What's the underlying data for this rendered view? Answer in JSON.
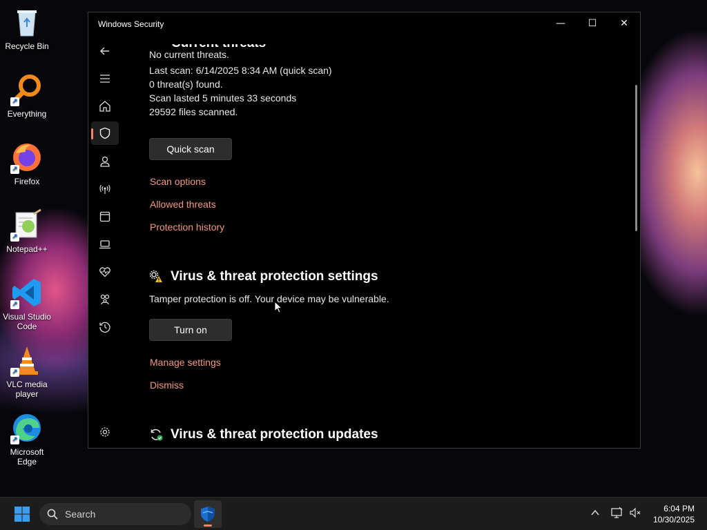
{
  "desktop": {
    "icons": [
      {
        "label": "Recycle Bin"
      },
      {
        "label": "Everything"
      },
      {
        "label": "Firefox"
      },
      {
        "label": "Notepad++"
      },
      {
        "label": "Visual Studio Code"
      },
      {
        "label": "VLC media player"
      },
      {
        "label": "Microsoft Edge"
      }
    ]
  },
  "window": {
    "title": "Windows Security",
    "controls": {
      "minimize": "—",
      "maximize": "☐",
      "close": "✕"
    }
  },
  "nav": {
    "items": [
      {
        "name": "back-icon"
      },
      {
        "name": "menu-icon"
      },
      {
        "name": "home-icon"
      },
      {
        "name": "shield-icon",
        "selected": true
      },
      {
        "name": "person-icon"
      },
      {
        "name": "wifi-antenna-icon"
      },
      {
        "name": "browser-icon"
      },
      {
        "name": "laptop-icon"
      },
      {
        "name": "heart-pulse-icon"
      },
      {
        "name": "family-icon"
      },
      {
        "name": "history-icon"
      },
      {
        "name": "settings-gear-icon"
      }
    ],
    "accent": "#f0866a"
  },
  "content": {
    "current_threats": {
      "heading": "Current threats",
      "status": "No current threats.",
      "last_scan": "Last scan: 6/14/2025 8:34 AM (quick scan)",
      "threats_found": "0 threat(s) found.",
      "duration": "Scan lasted 5 minutes 33 seconds",
      "files_scanned": "29592 files scanned.",
      "quick_scan_button": "Quick scan",
      "links": [
        "Scan options",
        "Allowed threats",
        "Protection history"
      ]
    },
    "settings": {
      "heading": "Virus & threat protection settings",
      "message": "Tamper protection is off. Your device may be vulnerable.",
      "button": "Turn on",
      "links": [
        "Manage settings",
        "Dismiss"
      ]
    },
    "updates": {
      "heading": "Virus & threat protection updates"
    },
    "link_color": "#f39a7b"
  },
  "taskbar": {
    "search_label": "Search",
    "time": "6:04 PM",
    "date": "10/30/2025"
  }
}
